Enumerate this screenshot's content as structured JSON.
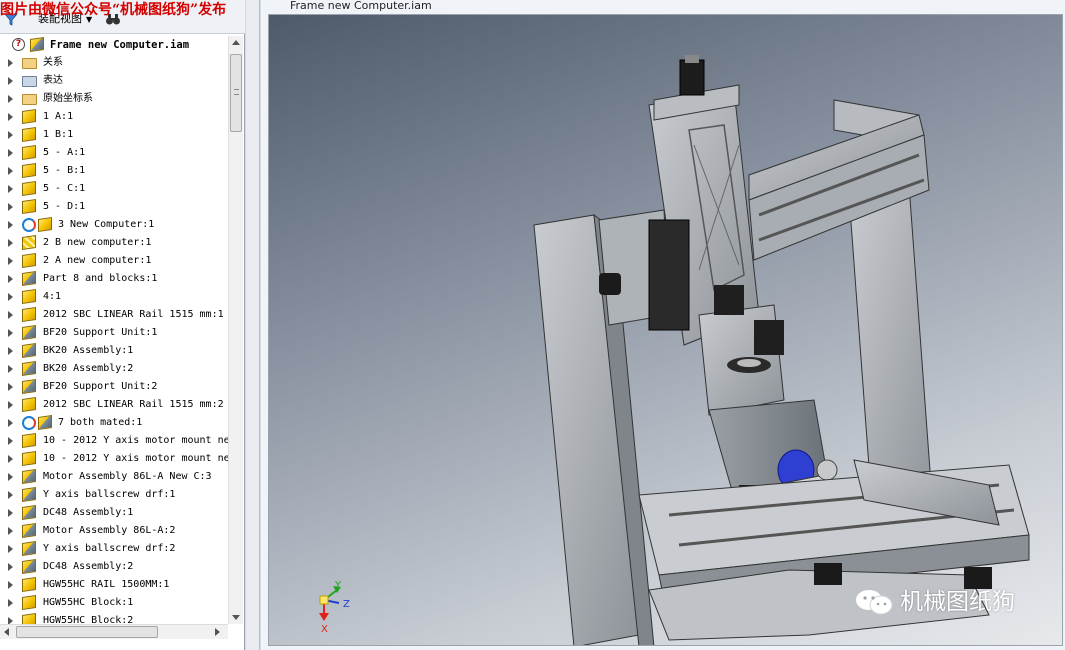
{
  "watermark_top": "图片由微信公众号“机械图纸狗”发布",
  "browser": {
    "view_label": "装配视图",
    "tree": [
      {
        "label": "Frame new Computer.iam",
        "icon": "question-assembly-icon",
        "root": true
      },
      {
        "label": "关系",
        "icon": "folder-icon"
      },
      {
        "label": "表达",
        "icon": "representations-icon"
      },
      {
        "label": "原始坐标系",
        "icon": "folder-icon"
      },
      {
        "label": "1 A:1",
        "icon": "part-icon"
      },
      {
        "label": "1 B:1",
        "icon": "part-icon"
      },
      {
        "label": "5 - A:1",
        "icon": "part-icon"
      },
      {
        "label": "5 - B:1",
        "icon": "part-icon"
      },
      {
        "label": "5 - C:1",
        "icon": "part-icon"
      },
      {
        "label": "5 - D:1",
        "icon": "part-icon"
      },
      {
        "label": "3 New Computer:1",
        "icon": "sync-part-icon"
      },
      {
        "label": "2 B new computer:1",
        "icon": "pattern-part-icon"
      },
      {
        "label": "2 A new computer:1",
        "icon": "part-icon"
      },
      {
        "label": "Part 8 and blocks:1",
        "icon": "assembly-icon"
      },
      {
        "label": "4:1",
        "icon": "part-icon"
      },
      {
        "label": "2012 SBC LINEAR Rail 1515 mm:1",
        "icon": "part-icon"
      },
      {
        "label": "BF20 Support Unit:1",
        "icon": "assembly-icon"
      },
      {
        "label": "BK20 Assembly:1",
        "icon": "assembly-icon"
      },
      {
        "label": "BK20 Assembly:2",
        "icon": "assembly-icon"
      },
      {
        "label": "BF20 Support Unit:2",
        "icon": "assembly-icon"
      },
      {
        "label": "2012 SBC LINEAR Rail 1515 mm:2",
        "icon": "part-icon"
      },
      {
        "label": "7 both mated:1",
        "icon": "sync-assembly-icon"
      },
      {
        "label": "10 - 2012 Y axis motor mount ne",
        "icon": "part-icon"
      },
      {
        "label": "10 - 2012 Y axis motor mount ne",
        "icon": "part-icon"
      },
      {
        "label": "Motor Assembly 86L-A New C:3",
        "icon": "assembly-icon"
      },
      {
        "label": "Y axis ballscrew drf:1",
        "icon": "assembly-icon"
      },
      {
        "label": "DC48 Assembly:1",
        "icon": "assembly-icon"
      },
      {
        "label": "Motor Assembly 86L-A:2",
        "icon": "assembly-icon"
      },
      {
        "label": "Y axis ballscrew drf:2",
        "icon": "assembly-icon"
      },
      {
        "label": "DC48 Assembly:2",
        "icon": "assembly-icon"
      },
      {
        "label": "HGW55HC RAIL 1500MM:1",
        "icon": "part-icon"
      },
      {
        "label": "HGW55HC Block:1",
        "icon": "part-icon"
      },
      {
        "label": "HGW55HC Block:2",
        "icon": "part-icon"
      }
    ]
  },
  "graphics": {
    "title": "Frame new Computer.iam",
    "triad": {
      "x": "X",
      "y": "Y",
      "z": "Z"
    },
    "colors": {
      "axis_x": "#e0201a",
      "axis_y": "#1fa51f",
      "axis_z": "#1d3fd6"
    }
  },
  "watermark_br": "机械图纸狗"
}
